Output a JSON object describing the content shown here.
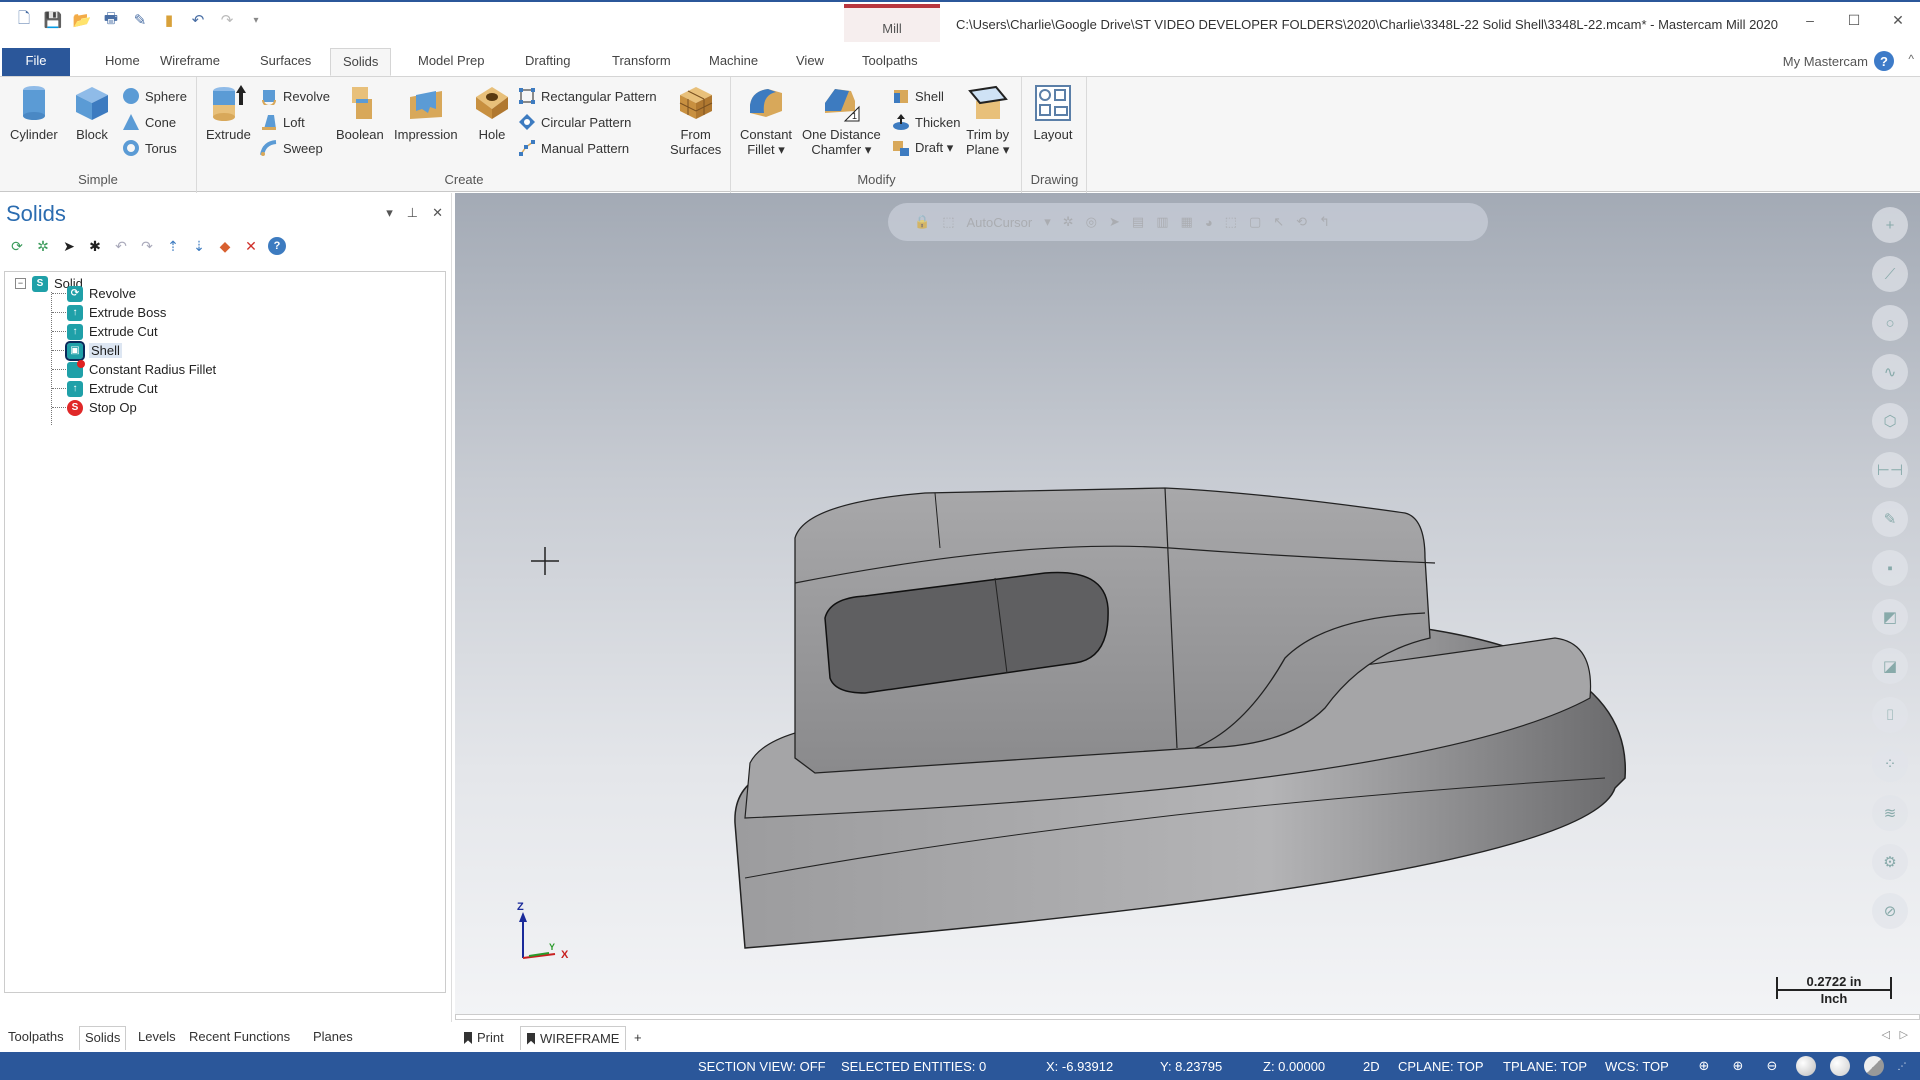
{
  "app": {
    "title": "C:\\Users\\Charlie\\Google Drive\\ST VIDEO DEVELOPER FOLDERS\\2020\\Charlie\\3348L-22 Solid Shell\\3348L-22.mcam* - Mastercam Mill 2020",
    "context_tab_group": "Mill",
    "window_controls": {
      "minimize": "–",
      "maximize": "☐",
      "close": "✕"
    }
  },
  "quick_access": [
    "new-icon",
    "save-icon",
    "open-icon",
    "print-icon",
    "save-as-icon",
    "folder-icon",
    "undo-icon",
    "redo-icon",
    "customize-icon"
  ],
  "tabs": [
    {
      "label": "File"
    },
    {
      "label": "Home"
    },
    {
      "label": "Wireframe"
    },
    {
      "label": "Surfaces"
    },
    {
      "label": "Solids",
      "active": true
    },
    {
      "label": "Model Prep"
    },
    {
      "label": "Drafting"
    },
    {
      "label": "Transform"
    },
    {
      "label": "Machine"
    },
    {
      "label": "View"
    },
    {
      "label": "Toolpaths"
    }
  ],
  "my_mastercam": "My Mastercam",
  "help": "?",
  "ribbon": {
    "groups": {
      "simple": "Simple",
      "create": "Create",
      "modify": "Modify",
      "drawing": "Drawing"
    },
    "simple": {
      "cylinder": "Cylinder",
      "block": "Block",
      "sphere": "Sphere",
      "cone": "Cone",
      "torus": "Torus"
    },
    "create": {
      "extrude": "Extrude",
      "revolve": "Revolve",
      "loft": "Loft",
      "sweep": "Sweep",
      "boolean": "Boolean",
      "impression": "Impression",
      "hole": "Hole",
      "rectangular_pattern": "Rectangular Pattern",
      "circular_pattern": "Circular Pattern",
      "manual_pattern": "Manual Pattern",
      "from_surfaces_1": "From",
      "from_surfaces_2": "Surfaces"
    },
    "modify": {
      "constant_fillet_1": "Constant",
      "constant_fillet_2": "Fillet ▾",
      "chamfer_1": "One Distance",
      "chamfer_2": "Chamfer ▾",
      "shell": "Shell",
      "thicken": "Thicken",
      "draft": "Draft ▾",
      "trim_1": "Trim by",
      "trim_2": "Plane ▾"
    },
    "drawing": {
      "layout": "Layout"
    }
  },
  "panel": {
    "title": "Solids",
    "controls": {
      "dropdown": "▾",
      "pin": "⊥",
      "close": "✕"
    },
    "tools": [
      "regenerate-all-icon",
      "regenerate-dirty-icon",
      "select-all-icon",
      "select-dirty-icon",
      "undo-icon",
      "redo-icon",
      "move-up-icon",
      "move-down-icon",
      "hide-solids-icon",
      "delete-icon",
      "help-icon"
    ],
    "tree": {
      "root": "Solid",
      "items": [
        {
          "label": "Revolve",
          "icon": "revolve"
        },
        {
          "label": "Extrude Boss",
          "icon": "extrude"
        },
        {
          "label": "Extrude Cut",
          "icon": "extrude"
        },
        {
          "label": "Shell",
          "icon": "shell",
          "selected": true
        },
        {
          "label": "Constant Radius Fillet",
          "icon": "fillet"
        },
        {
          "label": "Extrude Cut",
          "icon": "extrude"
        },
        {
          "label": "Stop Op",
          "icon": "stop"
        }
      ]
    }
  },
  "viewport": {
    "toolbar_label": "AutoCursor",
    "triad": {
      "z": "Z",
      "y": "Y",
      "x": "X"
    },
    "scale": {
      "value": "0.2722 in",
      "unit": "Inch"
    },
    "right_tools": [
      "point-icon",
      "line-icon",
      "circle-icon",
      "spline-icon",
      "solids-icon",
      "dimension-icon",
      "trim-icon",
      "translate-icon",
      "level-icon",
      "color-icon",
      "analyze-icon",
      "attributes-icon",
      "layers-icon",
      "settings-icon",
      "clear-icon"
    ]
  },
  "bottom_tabs": [
    {
      "label": "Toolpaths"
    },
    {
      "label": "Solids",
      "active": true
    },
    {
      "label": "Levels"
    },
    {
      "label": "Recent Functions"
    },
    {
      "label": "Planes"
    }
  ],
  "view_tabs": [
    {
      "label": "Print"
    },
    {
      "label": "WIREFRAME",
      "active": true
    },
    {
      "label": "+"
    }
  ],
  "status": {
    "section_view": "SECTION VIEW: OFF",
    "selected_entities": "SELECTED ENTITIES: 0",
    "x": "X:   -6.93912",
    "y": "Y:   8.23795",
    "z": "Z:   0.00000",
    "mode": "2D",
    "cplane": "CPLANE: TOP",
    "tplane": "TPLANE: TOP",
    "wcs": "WCS: TOP"
  },
  "colors": {
    "accent": "#2b579a",
    "mill_context": "#b8363e",
    "panel_title": "#2b6cb0"
  }
}
